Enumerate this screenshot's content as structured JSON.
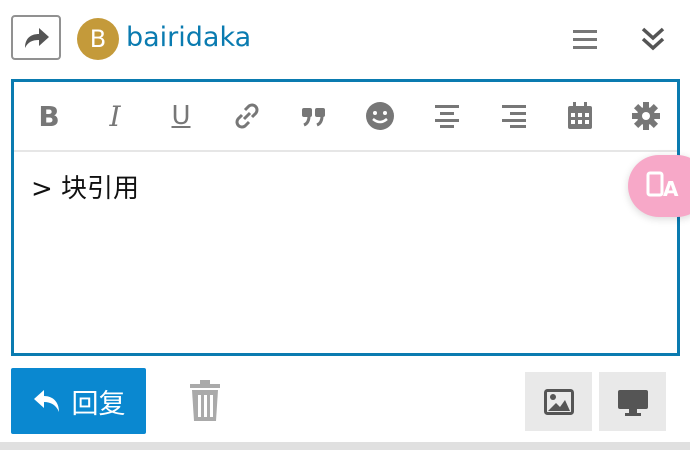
{
  "header": {
    "share_icon": "share-forward-icon",
    "avatar_letter": "B",
    "avatar_color": "#c49a3a",
    "username": "bairidaka",
    "menu_icon": "hamburger-icon",
    "collapse_icon": "double-chevron-down-icon"
  },
  "toolbar": {
    "items": [
      {
        "name": "bold",
        "glyph": "B"
      },
      {
        "name": "italic",
        "glyph": "I"
      },
      {
        "name": "underline",
        "glyph": "U"
      },
      {
        "name": "link",
        "icon": "link-icon"
      },
      {
        "name": "blockquote",
        "glyph": "❞"
      },
      {
        "name": "emoji",
        "icon": "smiley-icon"
      },
      {
        "name": "align-center",
        "icon": "align-center-icon"
      },
      {
        "name": "align-right",
        "icon": "align-right-icon"
      },
      {
        "name": "date",
        "icon": "calendar-icon"
      },
      {
        "name": "settings",
        "icon": "gear-icon"
      }
    ]
  },
  "editor": {
    "content": "> 块引用"
  },
  "footer": {
    "reply_label": "回复",
    "trash_icon": "trash-icon",
    "upload_icon": "image-icon",
    "preview_icon": "monitor-icon"
  },
  "colors": {
    "accent": "#0a88d0",
    "border": "#0a7bb0",
    "translate_bubble": "#f7a8c8"
  }
}
